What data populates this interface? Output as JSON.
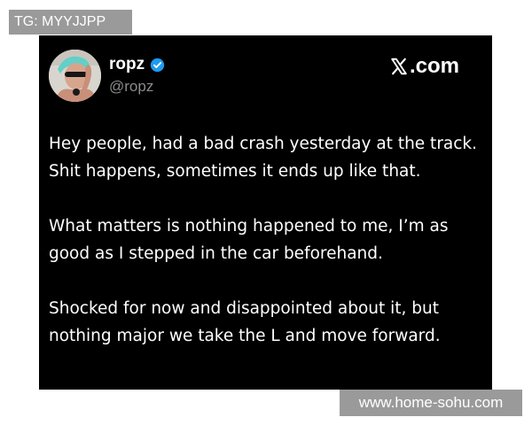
{
  "overlay": {
    "tg_label": "TG: MYYJJPP",
    "watermark_label": "www.home-sohu.com"
  },
  "tweet": {
    "display_name": "ropz",
    "handle": "@ropz",
    "brand": ".com",
    "verified_icon": "verified-badge-icon",
    "verified_color": "#1d9bf0",
    "paragraphs": [
      "Hey people, had a bad crash yesterday at the track. Shit happens, sometimes it ends up like that.",
      "What matters is nothing happened to me, I’m as good as I stepped in the car beforehand.",
      "Shocked for now and disappointed about it, but nothing major we take the L and move forward."
    ]
  },
  "colors": {
    "card_background": "#000000",
    "text": "#ffffff",
    "handle": "#8b8b8b",
    "overlay_background": "#9a9a9a"
  }
}
